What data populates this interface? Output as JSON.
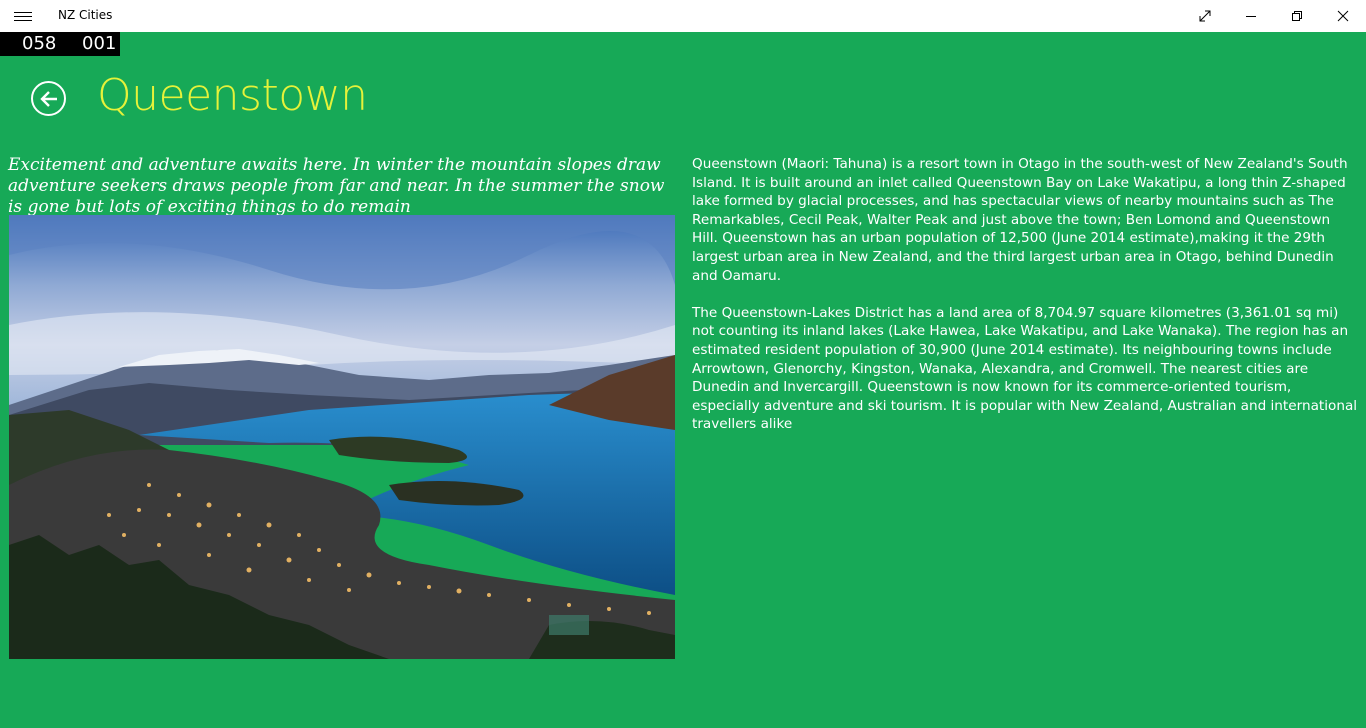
{
  "window": {
    "title": "NZ Cities",
    "menu_icon": "hamburger-icon",
    "controls": [
      "fullscreen-icon",
      "minimize-icon",
      "restore-icon",
      "close-icon"
    ]
  },
  "frame_counter": {
    "left": "058",
    "right": "001"
  },
  "header": {
    "back_icon": "arrow-left-icon",
    "title": "Queenstown"
  },
  "tagline": "Excitement and adventure awaits here. In winter the mountain slopes draw adventure seekers draws people from far and near. In the summer the snow is gone but lots of exciting things to do remain",
  "description": {
    "paragraphs": [
      "Queenstown (Maori: Tahuna) is a resort town in Otago in the south-west of New Zealand's South Island. It is built around an inlet called Queenstown Bay on Lake Wakatipu, a long thin Z-shaped lake formed by glacial processes, and has spectacular views of nearby mountains such as The Remarkables, Cecil Peak, Walter Peak and just above the town; Ben Lomond and Queenstown Hill. Queenstown has an urban population of 12,500 (June 2014 estimate),making it the 29th largest urban area in New Zealand, and the third largest urban area in Otago, behind Dunedin and Oamaru.",
      "The Queenstown-Lakes District has a land area of 8,704.97 square kilometres (3,361.01 sq mi) not counting its inland lakes (Lake Hawea, Lake Wakatipu, and Lake Wanaka). The region has an estimated resident population of 30,900 (June 2014 estimate). Its neighbouring towns include Arrowtown, Glenorchy, Kingston, Wanaka, Alexandra, and Cromwell. The nearest cities are Dunedin and Invercargill. Queenstown is now known for its commerce-oriented tourism, especially adventure and ski tourism. It is popular with New Zealand, Australian and international travellers alike"
    ]
  },
  "colors": {
    "background": "#17a957",
    "title": "#e6f23a",
    "text": "#ffffff",
    "titlebar": "#ffffff"
  }
}
